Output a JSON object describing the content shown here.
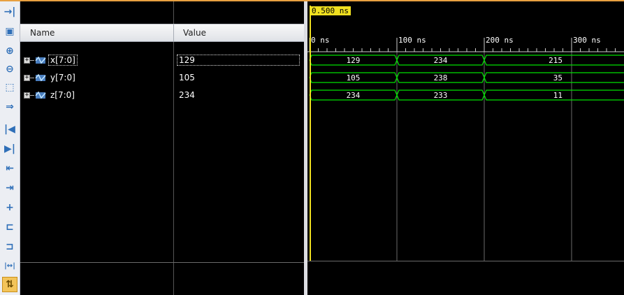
{
  "toolbar": {
    "items": [
      {
        "name": "go-to-time-icon",
        "glyph": "→|"
      },
      {
        "name": "save-icon",
        "glyph": "▣"
      },
      {
        "name": "zoom-in-icon",
        "glyph": "⊕"
      },
      {
        "name": "zoom-out-icon",
        "glyph": "⊖"
      },
      {
        "name": "zoom-fit-icon",
        "glyph": "⬚"
      },
      {
        "name": "go-to-cursor-icon",
        "glyph": "⇒"
      },
      {
        "name": "go-to-start-icon",
        "glyph": "|◀"
      },
      {
        "name": "go-to-end-icon",
        "glyph": "▶|"
      },
      {
        "name": "previous-transition-icon",
        "glyph": "⇤"
      },
      {
        "name": "next-transition-icon",
        "glyph": "⇥"
      },
      {
        "name": "add-marker-icon",
        "glyph": "+"
      },
      {
        "name": "previous-marker-icon",
        "glyph": "⊏"
      },
      {
        "name": "next-marker-icon",
        "glyph": "⊐"
      },
      {
        "name": "swap-cursors-icon",
        "glyph": "|↔|"
      },
      {
        "name": "snap-to-transition-icon",
        "glyph": "⇅"
      }
    ]
  },
  "columns": {
    "name": "Name",
    "value": "Value"
  },
  "signals": [
    {
      "name": "x[7:0]",
      "value": "129",
      "segments": [
        "129",
        "234",
        "215"
      ]
    },
    {
      "name": "y[7:0]",
      "value": "105",
      "segments": [
        "105",
        "238",
        "35"
      ]
    },
    {
      "name": "z[7:0]",
      "value": "234",
      "segments": [
        "234",
        "233",
        "11"
      ]
    }
  ],
  "cursor": {
    "label": "0.500 ns"
  },
  "timeline": {
    "labels": [
      "0 ns",
      "100 ns",
      "200 ns",
      "300 ns"
    ]
  },
  "colors": {
    "wave": "#00e000",
    "cursor": "#f0e020",
    "grid": "#6a6a6a",
    "accent": "#e8a040"
  }
}
